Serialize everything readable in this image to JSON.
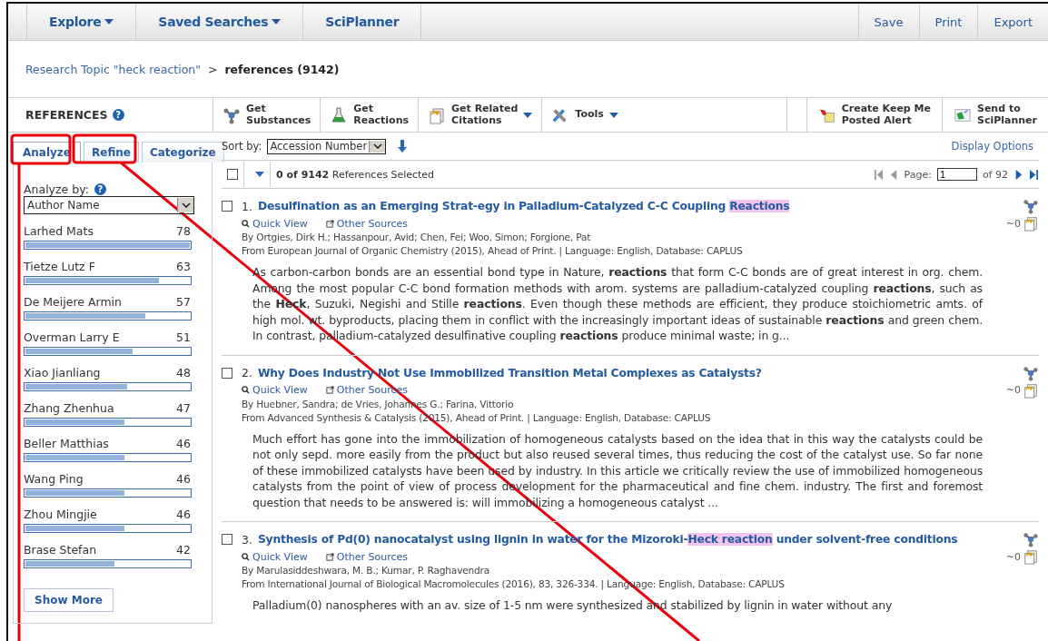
{
  "nav": {
    "items": [
      {
        "label": "Explore",
        "dropdown": true
      },
      {
        "label": "Saved Searches",
        "dropdown": true
      },
      {
        "label": "SciPlanner",
        "dropdown": false
      }
    ],
    "actions": [
      "Save",
      "Print",
      "Export"
    ]
  },
  "breadcrumb": {
    "link": "Research Topic \"heck reaction\"",
    "separator": ">",
    "current": "references (9142)"
  },
  "panel_title": "REFERENCES",
  "panel_help": "?",
  "toolbar": {
    "left": [
      {
        "kind": "substances",
        "line1": "Get",
        "line2": "Substances",
        "dropdown": false
      },
      {
        "kind": "reactions",
        "line1": "Get",
        "line2": "Reactions",
        "dropdown": false
      },
      {
        "kind": "citations",
        "line1": "Get Related",
        "line2": "Citations",
        "dropdown": true
      },
      {
        "kind": "tools",
        "line1": "Tools",
        "dropdown": true
      }
    ],
    "right": [
      {
        "kind": "alert",
        "line1": "Create Keep Me",
        "line2": "Posted Alert"
      },
      {
        "kind": "planner",
        "line1": "Send to",
        "line2": "SciPlanner"
      }
    ]
  },
  "tabs": [
    {
      "label": "Analyze",
      "selected": true
    },
    {
      "label": "Refine",
      "selected": false
    },
    {
      "label": "Categorize",
      "selected": false
    }
  ],
  "analyze": {
    "label": "Analyze by:",
    "help": "?",
    "select_value": "Author Name",
    "show_more": "Show More",
    "authors": [
      {
        "name": "Larhed Mats",
        "count": "78",
        "level": 1.0
      },
      {
        "name": "Tietze Lutz F",
        "count": "63",
        "level": 0.81
      },
      {
        "name": "De Meijere Armin",
        "count": "57",
        "level": 0.73
      },
      {
        "name": "Overman Larry E",
        "count": "51",
        "level": 0.65
      },
      {
        "name": "Xiao Jianliang",
        "count": "48",
        "level": 0.62
      },
      {
        "name": "Zhang Zhenhua",
        "count": "47",
        "level": 0.6
      },
      {
        "name": "Beller Matthias",
        "count": "46",
        "level": 0.6
      },
      {
        "name": "Wang Ping",
        "count": "46",
        "level": 0.6
      },
      {
        "name": "Zhou Mingjie",
        "count": "46",
        "level": 0.6
      },
      {
        "name": "Brase Stefan",
        "count": "42",
        "level": 0.54
      }
    ]
  },
  "sort": {
    "label": "Sort by:",
    "value": "Accession Number",
    "display_options": "Display Options"
  },
  "selection": {
    "checked": false,
    "count": "0 of 9142",
    "text": "References Selected"
  },
  "pager": {
    "label": "Page:",
    "value": "1",
    "of": "of 92"
  },
  "results": [
    {
      "number": "1.",
      "checked": false,
      "title": [
        {
          "text": "Desulfination as an Emerging Strat-egy in Palladium-Catalyzed C-C Coupling ",
          "highlight": false
        },
        {
          "text": "Reactions",
          "highlight": true
        }
      ],
      "quick_view": "Quick View",
      "other_sources": "Other Sources",
      "authors": "By Ortgies, Dirk H.; Hassanpour, Avid; Chen, Fei; Woo, Simon; Forgione, Pat",
      "source": "From European Journal of Organic Chemistry (2015), Ahead of Print.  |  Language: English, Database: CAPLUS",
      "citing": "~0",
      "abstract": "As carbon-carbon bonds are an essential bond type in Nature, **reactions** that form C-C bonds are of great interest in org. chem.  Among the most popular C-C bond formation methods with arom. systems are palladium-catalyzed coupling **reactions**, such as the **Heck**, Suzuki, Negishi and Stille **reactions**.  Even though these methods are efficient, they produce stoichiometric amts. of high mol. wt. byproducts, placing them in conflict with the increasingly important ideas of sustainable **reactions** and green chem.  In contrast, palladium-catalyzed desulfinative coupling **reactions** produce minimal waste; in g..."
    },
    {
      "number": "2.",
      "checked": false,
      "title": [
        {
          "text": "Why Does Industry Not Use Immobilized Transition Metal Complexes as Catalysts?",
          "highlight": false
        }
      ],
      "quick_view": "Quick View",
      "other_sources": "Other Sources",
      "authors": "By Huebner, Sandra; de Vries, Johannes G.; Farina, Vittorio",
      "source": "From Advanced Synthesis & Catalysis (2015), Ahead of Print.  |  Language: English, Database: CAPLUS",
      "citing": "~0",
      "abstract": "Much effort has gone into the immobilization of homogeneous catalysts based on the idea that in this way the catalysts could be not only sepd. more easily from the product but also reused several times, thus reducing the cost of the catalyst use.  So far none of these immobilized catalysts have been used by industry.  In this article we critically review the use of immobilized homogeneous catalysts from the point of view of process development for the pharmaceutical and fine chem. industry.  The first and foremost question that needs to be answered is: will immobilizing a homogeneous catalyst ..."
    },
    {
      "number": "3.",
      "checked": false,
      "title": [
        {
          "text": "Synthesis of Pd(0) nanocatalyst using lignin in water for the Mizoroki-",
          "highlight": false
        },
        {
          "text": "Heck reaction",
          "highlight": true
        },
        {
          "text": " under solvent-free conditions",
          "highlight": false
        }
      ],
      "quick_view": "Quick View",
      "other_sources": "Other Sources",
      "authors": "By Marulasiddeshwara, M. B.; Kumar, P. Raghavendra",
      "source": "From International Journal of Biological Macromolecules (2016), 83, 326-334.  |  Language: English, Database: CAPLUS",
      "citing": "~0",
      "abstract": "Palladium(0) nanospheres with an av. size of 1-5 nm were synthesized and stabilized by lignin in water without any"
    }
  ]
}
